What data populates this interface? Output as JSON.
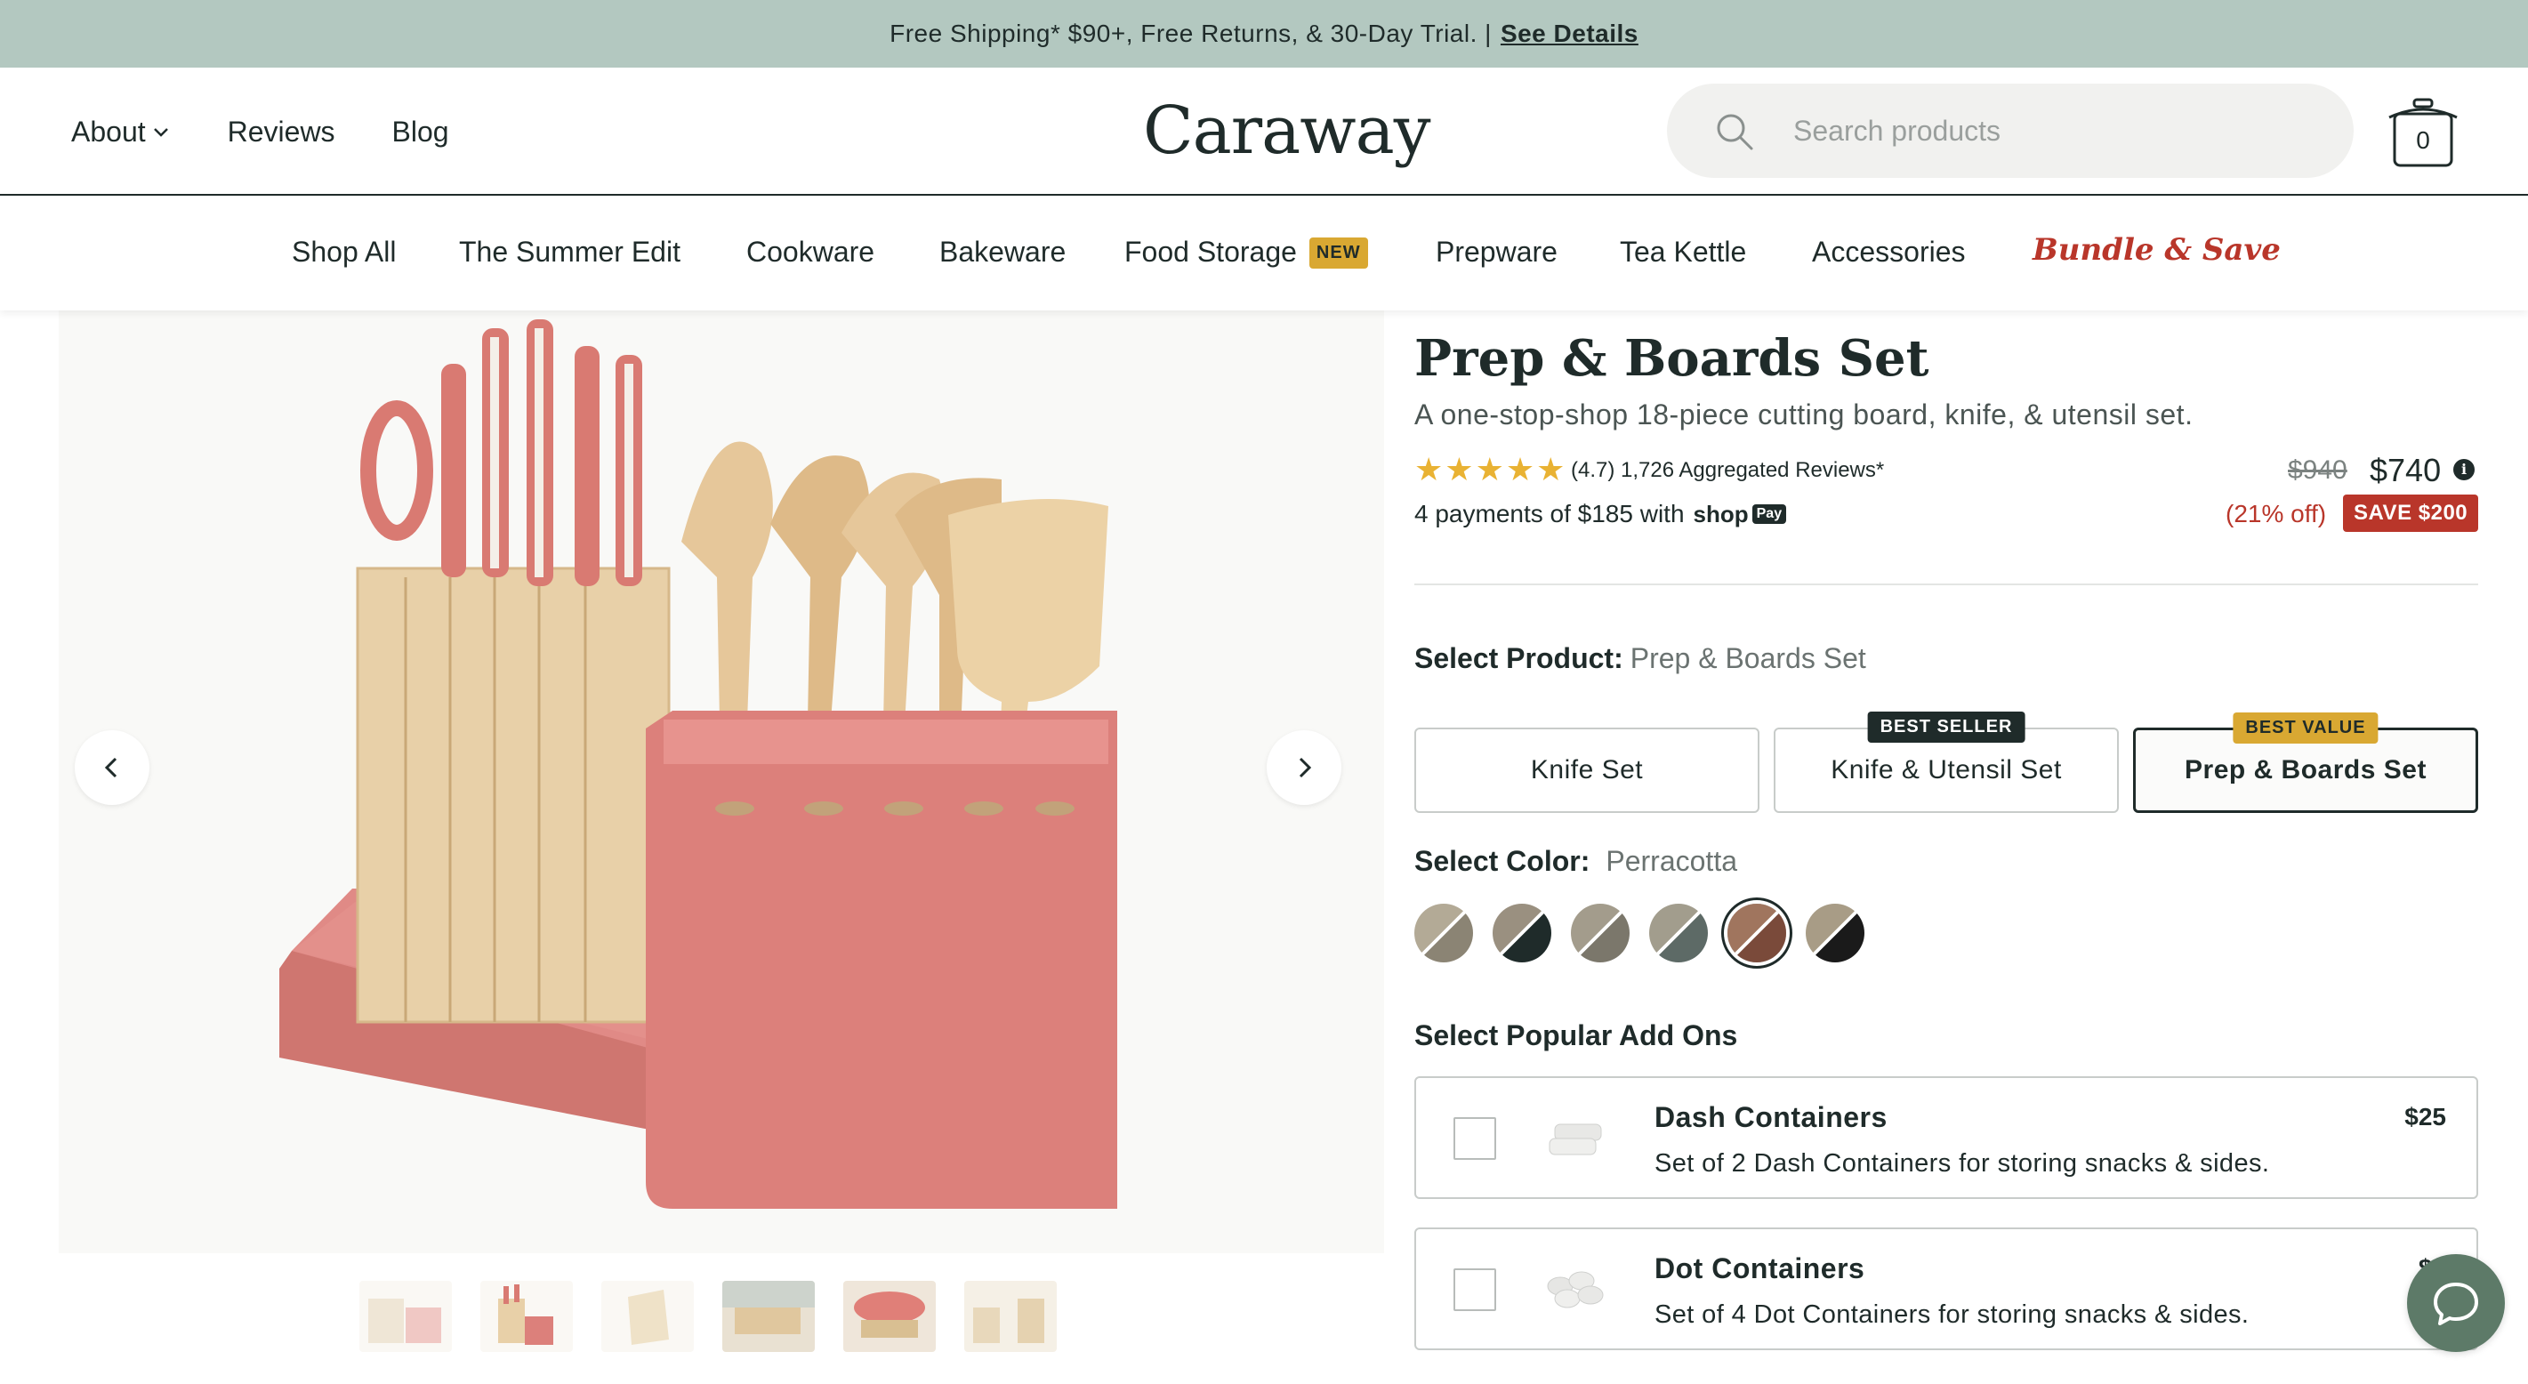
{
  "announcement": {
    "text": "Free Shipping* $90+, Free Returns, & 30-Day Trial. |",
    "link": "See Details"
  },
  "header": {
    "nav": {
      "about": "About",
      "reviews": "Reviews",
      "blog": "Blog"
    },
    "logo": "Caraway",
    "search": {
      "placeholder": "Search products",
      "value": ""
    },
    "cart_count": "0"
  },
  "categories": {
    "shop_all": "Shop All",
    "summer_edit": "The Summer Edit",
    "cookware": "Cookware",
    "bakeware": "Bakeware",
    "food_storage": "Food Storage",
    "food_storage_badge": "NEW",
    "prepware": "Prepware",
    "tea_kettle": "Tea Kettle",
    "accessories": "Accessories",
    "bundle": "Bundle & Save"
  },
  "product": {
    "title": "Prep & Boards Set",
    "subtitle": "A one-stop-shop 18-piece cutting board, knife, & utensil set.",
    "rating_stars": 5,
    "rating_text": "(4.7) 1,726 Aggregated Reviews*",
    "payments_text": "4 payments of $185 with",
    "shop_pay": {
      "shop": "shop",
      "pay": "Pay"
    },
    "price_old": "$940",
    "price_new": "$740",
    "info_icon": "i",
    "percent_off": "(21% off)",
    "save_badge": "SAVE $200"
  },
  "select_product": {
    "label": "Select Product:",
    "value": "Prep & Boards Set",
    "options": [
      {
        "label": "Knife Set",
        "ribbon": ""
      },
      {
        "label": "Knife & Utensil Set",
        "ribbon": "BEST SELLER"
      },
      {
        "label": "Prep & Boards Set",
        "ribbon": "BEST VALUE"
      }
    ]
  },
  "select_color": {
    "label": "Select Color:",
    "value": "Perracotta",
    "swatches": [
      {
        "name": "swatch-1",
        "a": "#8b8474",
        "b": "#b3aa96"
      },
      {
        "name": "swatch-2",
        "a": "#1f2b2a",
        "b": "#9a9080"
      },
      {
        "name": "swatch-3",
        "a": "#7b776b",
        "b": "#a39c8c"
      },
      {
        "name": "swatch-4",
        "a": "#5d6a66",
        "b": "#a29d8d"
      },
      {
        "name": "swatch-5",
        "a": "#7a4a3a",
        "b": "#a0755e"
      },
      {
        "name": "swatch-6",
        "a": "#1a1a1a",
        "b": "#a89c86"
      }
    ]
  },
  "addons": {
    "label": "Select Popular Add Ons",
    "items": [
      {
        "name": "Dash Containers",
        "desc": "Set of 2 Dash Containers for storing snacks & sides.",
        "price": "$25"
      },
      {
        "name": "Dot Containers",
        "desc": "Set of 4 Dot Containers for storing snacks & sides.",
        "price": "$2"
      }
    ]
  },
  "colors": {
    "announcement_bg": "#b3c8c0",
    "terracotta": "#d9827c",
    "accent_red": "#b9362a",
    "badge_gold": "#d9a832",
    "chat_green": "#5d7a68"
  }
}
